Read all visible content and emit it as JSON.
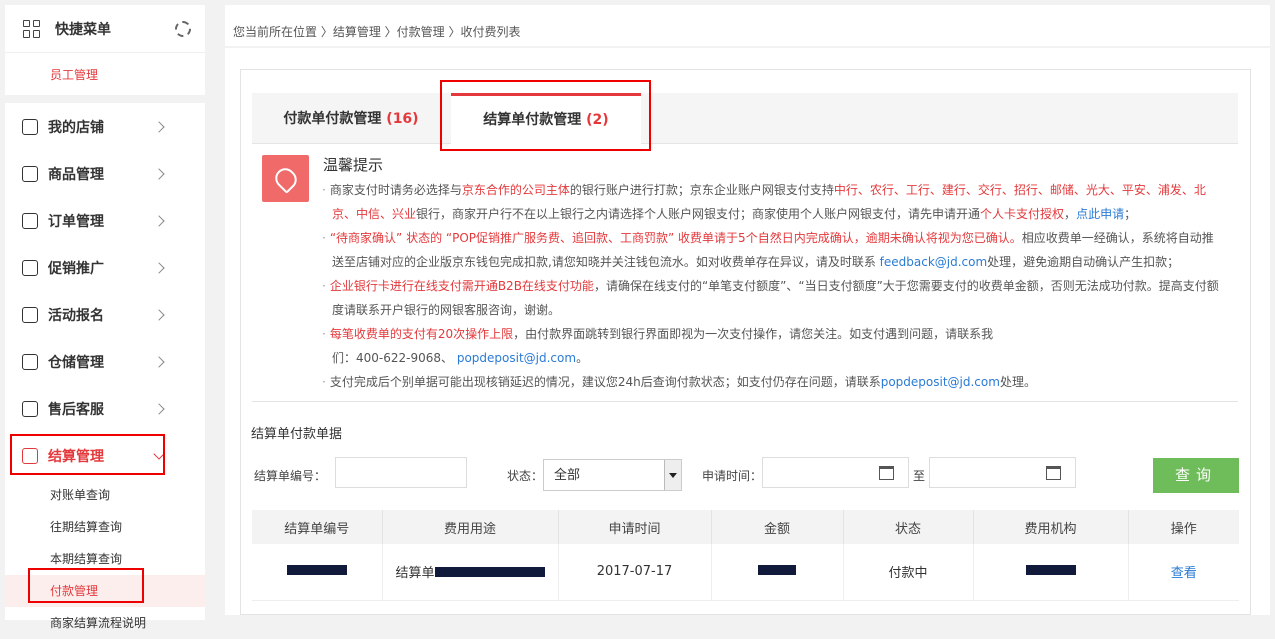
{
  "sidebar": {
    "quick_menu": "快捷菜单",
    "staff": "员工管理",
    "items": [
      {
        "label": "我的店铺"
      },
      {
        "label": "商品管理"
      },
      {
        "label": "订单管理"
      },
      {
        "label": "促销推广"
      },
      {
        "label": "活动报名"
      },
      {
        "label": "仓储管理"
      },
      {
        "label": "售后客服"
      },
      {
        "label": "结算管理"
      }
    ],
    "sub_items": [
      "对账单查询",
      "往期结算查询",
      "本期结算查询",
      "付款管理",
      "商家结算流程说明"
    ]
  },
  "breadcrumb": "您当前所在位置 〉结算管理 〉付款管理 〉收付费列表",
  "tabs": [
    {
      "label": "付款单付款管理",
      "count": "(16)"
    },
    {
      "label": "结算单付款管理",
      "count": "(2)"
    }
  ],
  "tip": {
    "title": "温馨提示",
    "l1a": "商家支付时请务必选择与",
    "l1b": "京东合作的公司主体",
    "l1c": "的银行账户进行打款；京东企业账户网银支付支持",
    "l1d": "中行、农行、工行、建行、交行、招行、邮储、光大、平安、浦发、北",
    "l2a": "京、中信、兴业",
    "l2b": "银行，商家开户行不在以上银行之内请选择个人账户网银支付；商家使用个人账户网银支付，请先申请开通",
    "l2c": "个人卡支付授权",
    "l2d": "，",
    "l2e": "点此申请",
    "l2f": "；",
    "l3a": "“待商家确认” 状态的 “POP促销推广服务费、追回款、工商罚款” 收费单请于5个自然日内完成确认，逾期未确认将视为您已确认。",
    "l3b": "相应收费单一经确认，系统将自动推",
    "l4a": "送至店铺对应的企业版京东钱包完成扣款,请您知晓并关注钱包流水。如对收费单存在异议，请及时联系 ",
    "l4b": "feedback@jd.com",
    "l4c": "处理，避免逾期自动确认产生扣款；",
    "l5a": "企业银行卡进行在线支付需开通B2B在线支付功能",
    "l5b": "，请确保在线支付的“单笔支付额度”、“当日支付额度”大于您需要支付的收费单金额，否则无法成功付款。提高支付额",
    "l6": "度请联系开户银行的网银客服咨询，谢谢。",
    "l7a": "每笔收费单的支付有20次操作上限",
    "l7b": "，由付款界面跳转到银行界面即视为一次支付操作，请您关注。如支付遇到问题，请联系我",
    "l8a": "们：400-622-9068、  ",
    "l8b": "popdeposit@jd.com",
    "l8c": "。",
    "l9a": "支付完成后个别单据可能出现核销延迟的情况，建议您24h后查询付款状态；如支付仍存在问题，请联系",
    "l9b": "popdeposit@jd.com",
    "l9c": "处理。"
  },
  "section_title": "结算单付款单据",
  "filters": {
    "order_no_label": "结算单编号：",
    "status_label": "状态：",
    "status_value": "全部",
    "apply_time_label": "申请时间：",
    "to_label": "至",
    "query_button": "查询"
  },
  "table": {
    "headers": [
      "结算单编号",
      "费用用途",
      "申请时间",
      "金额",
      "状态",
      "费用机构",
      "操作"
    ],
    "rows": [
      {
        "purpose_prefix": "结算单",
        "date": "2017-07-17",
        "status": "付款中",
        "action": "查看"
      }
    ]
  },
  "colors": {
    "accent": "#e4393c",
    "link": "#2a7bd4",
    "query_button": "#6fbc5a",
    "highlight": "#e00000"
  }
}
